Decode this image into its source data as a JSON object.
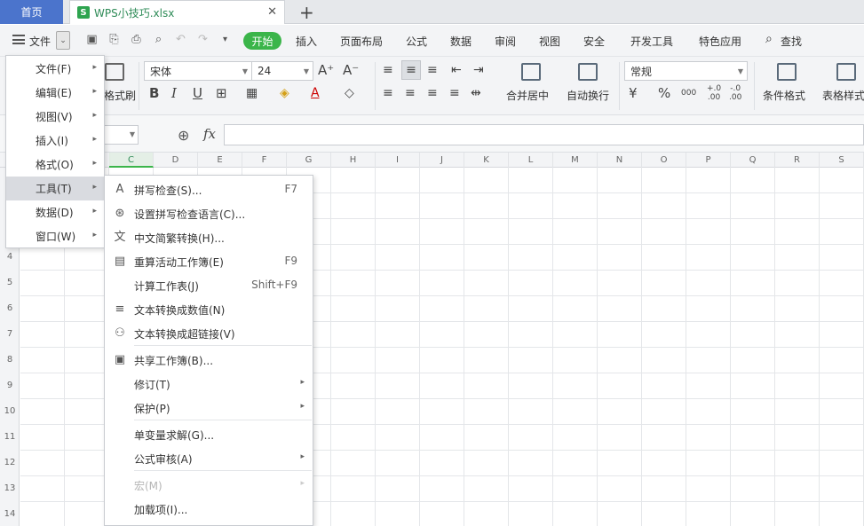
{
  "tabs": {
    "home": "首页",
    "file_logo": "S",
    "file": "WPS小技巧.xlsx",
    "close": "✕",
    "new": "+"
  },
  "menubar": {
    "file_label": "文件",
    "dropdown": "⌄",
    "items": [
      "开始",
      "插入",
      "页面布局",
      "公式",
      "数据",
      "审阅",
      "视图",
      "安全",
      "开发工具",
      "特色应用"
    ],
    "search": "查找"
  },
  "ribbon": {
    "format_painter": "格式刷",
    "font_name": "宋体",
    "font_size": "24",
    "grow": "A⁺",
    "shrink": "A⁻",
    "bold": "B",
    "italic": "I",
    "underline": "U",
    "merge_center": "合并居中",
    "wrap_text": "自动换行",
    "number_format": "常规",
    "percent": "%",
    "thousands": "000",
    "inc_decimal": "+.0\n.00",
    "dec_decimal": "-.0\n.00",
    "conditional_format": "条件格式",
    "table_style": "表格样式"
  },
  "formula_bar": {
    "fx": "fx",
    "value": ""
  },
  "columns": [
    "C",
    "D",
    "E",
    "F",
    "G",
    "H",
    "I",
    "J",
    "K",
    "L",
    "M",
    "N",
    "O",
    "P",
    "Q",
    "R",
    "S"
  ],
  "selected_column": "C",
  "rows": [
    "4",
    "5",
    "6",
    "7",
    "8",
    "9",
    "10",
    "11",
    "12",
    "13",
    "14"
  ],
  "main_menu": [
    {
      "label": "文件(F)",
      "active": false
    },
    {
      "label": "编辑(E)",
      "active": false
    },
    {
      "label": "视图(V)",
      "active": false
    },
    {
      "label": "插入(I)",
      "active": false
    },
    {
      "label": "格式(O)",
      "active": false
    },
    {
      "label": "工具(T)",
      "active": true
    },
    {
      "label": "数据(D)",
      "active": false
    },
    {
      "label": "窗口(W)",
      "active": false
    }
  ],
  "tools_submenu": [
    {
      "icon": "spellcheck-icon",
      "glyph": "A",
      "label": "拼写检查(S)...",
      "shortcut": "F7"
    },
    {
      "icon": "language-icon",
      "glyph": "⊛",
      "label": "设置拼写检查语言(C)...",
      "shortcut": ""
    },
    {
      "icon": "convert-chinese-icon",
      "glyph": "文",
      "label": "中文简繁转换(H)...",
      "shortcut": ""
    },
    {
      "icon": "recalc-workbook-icon",
      "glyph": "▤",
      "label": "重算活动工作簿(E)",
      "shortcut": "F9"
    },
    {
      "icon": "",
      "glyph": "",
      "label": "计算工作表(J)",
      "shortcut": "Shift+F9"
    },
    {
      "icon": "text-to-number-icon",
      "glyph": "≡",
      "label": "文本转换成数值(N)",
      "shortcut": ""
    },
    {
      "icon": "text-to-link-icon",
      "glyph": "⚇",
      "label": "文本转换成超链接(V)",
      "shortcut": ""
    },
    {
      "icon": "share-workbook-icon",
      "glyph": "▣",
      "label": "共享工作簿(B)...",
      "shortcut": ""
    },
    {
      "icon": "",
      "glyph": "",
      "label": "修订(T)",
      "shortcut": "",
      "submenu": true
    },
    {
      "icon": "",
      "glyph": "",
      "label": "保护(P)",
      "shortcut": "",
      "submenu": true
    },
    {
      "icon": "",
      "glyph": "",
      "label": "单变量求解(G)...",
      "shortcut": ""
    },
    {
      "icon": "",
      "glyph": "",
      "label": "公式审核(A)",
      "shortcut": "",
      "submenu": true
    },
    {
      "icon": "",
      "glyph": "",
      "label": "宏(M)",
      "shortcut": "",
      "submenu": true,
      "disabled": true
    },
    {
      "icon": "",
      "glyph": "",
      "label": "加载项(I)...",
      "shortcut": ""
    }
  ]
}
